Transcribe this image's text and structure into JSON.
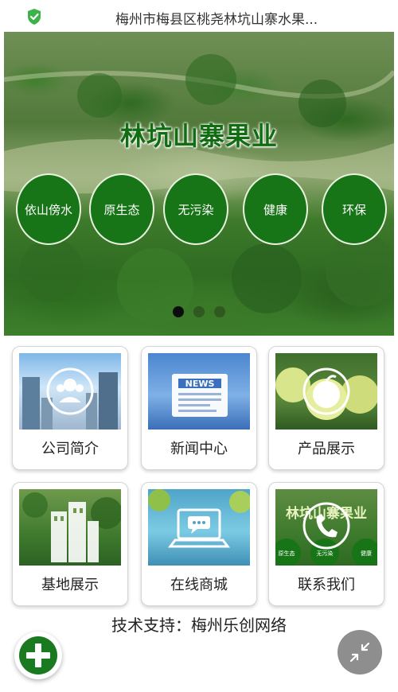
{
  "header": {
    "title": "梅州市梅县区桃尧林坑山寨水果...",
    "secure_icon": "shield-check-icon"
  },
  "banner": {
    "title": "林坑山寨果业",
    "badges": [
      "依山傍水",
      "原生态",
      "无污染",
      "健康",
      "环保"
    ],
    "slide_count": 3,
    "active_slide": 1
  },
  "tiles": [
    {
      "label": "公司简介",
      "icon": "people-icon"
    },
    {
      "label": "新闻中心",
      "icon": "news-icon",
      "image_text": "NEWS"
    },
    {
      "label": "产品展示",
      "icon": "pomelo-icon"
    },
    {
      "label": "基地展示",
      "icon": "building-icon"
    },
    {
      "label": "在线商城",
      "icon": "laptop-chat-icon"
    },
    {
      "label": "联系我们",
      "icon": "phone-icon",
      "image_text": "林坑山寨果业",
      "image_badges": [
        "原生态",
        "无污染",
        "健康"
      ]
    }
  ],
  "footer": {
    "text": "技术支持：梅州乐创网络"
  },
  "fab": {
    "add_icon": "plus-icon",
    "collapse_icon": "collapse-arrows-icon"
  },
  "colors": {
    "brand_green": "#177417",
    "fab_gray": "#8e8e8e"
  }
}
